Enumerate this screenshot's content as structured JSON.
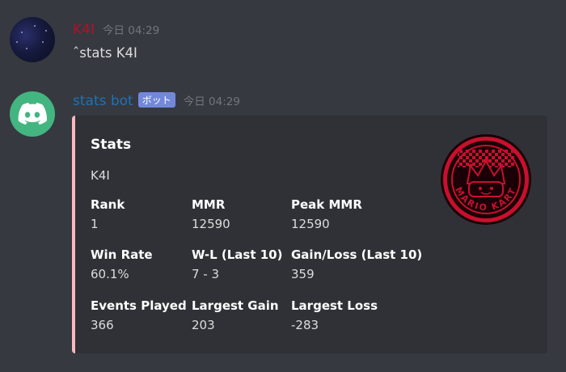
{
  "messages": {
    "user": {
      "username": "K4I",
      "timestamp": "今日 04:29",
      "text": "ˆstats K4I",
      "avatar_icon": "starry-night-avatar",
      "username_color": "#b3102b"
    },
    "bot": {
      "username": "stats bot",
      "bot_tag": "ボット",
      "timestamp": "今日 04:29",
      "avatar_icon": "discord-logo-avatar",
      "username_color": "#1e72b8"
    }
  },
  "embed": {
    "accent_color": "#ffb6c1",
    "title": "Stats",
    "description": "K4I",
    "thumbnail_icon": "mario-kart-crown-emblem",
    "thumbnail_text": "MARIO KART",
    "fields": [
      {
        "name": "Rank",
        "value": "1"
      },
      {
        "name": "MMR",
        "value": "12590"
      },
      {
        "name": "Peak MMR",
        "value": "12590"
      },
      {
        "name": "Win Rate",
        "value": "60.1%"
      },
      {
        "name": "W-L (Last 10)",
        "value": "7 - 3"
      },
      {
        "name": "Gain/Loss (Last 10)",
        "value": "359"
      },
      {
        "name": "Events Played",
        "value": "366"
      },
      {
        "name": "Largest Gain",
        "value": "203"
      },
      {
        "name": "Largest Loss",
        "value": "-283"
      }
    ]
  }
}
